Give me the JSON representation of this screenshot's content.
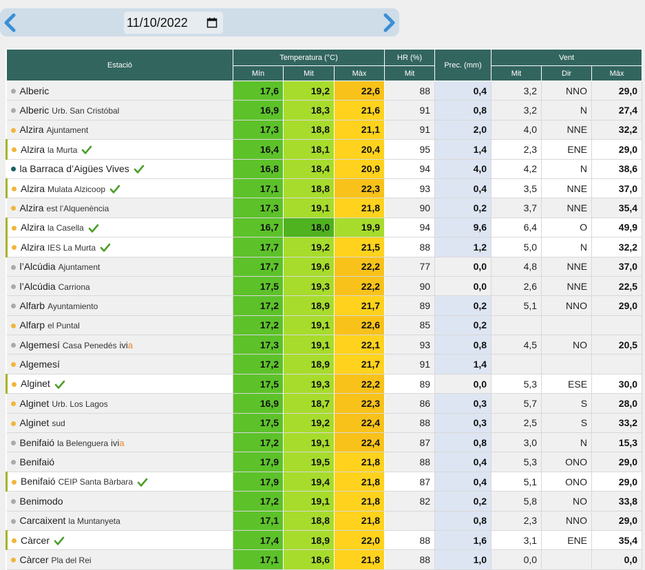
{
  "date": {
    "value": "11/10/2022"
  },
  "headers": {
    "station": "Estació",
    "temperature": "Temperatura (°C)",
    "humidity": "HR (%)",
    "precip": "Prec. (mm)",
    "wind": "Vent",
    "min": "Mín",
    "mit": "Mit",
    "max": "Màx",
    "dir": "Dir"
  },
  "colors": {
    "header_bg": "#33655f",
    "min_cell": "#5dc22a",
    "min_cell_dark": "#4fb21f",
    "mit_cell": "#a7dc2c",
    "max_cell": "#ffd21d",
    "max_cell_orange": "#f8c21a",
    "precip_bg": "#dde5f2",
    "check": "#4d9f2a",
    "nav_arrow": "#3b8fd6"
  },
  "rows": [
    {
      "name": "Alberic",
      "sub": "",
      "dot": "grey",
      "check": false,
      "hl": false,
      "ivia": false,
      "tmin": "17,6",
      "tmit": "19,2",
      "tmax": "22,6",
      "hr": "88",
      "prec": "0,4",
      "vmit": "3,2",
      "dir": "NNO",
      "vmax": "29,0"
    },
    {
      "name": "Alberic",
      "sub": "Urb. San Cristóbal",
      "dot": "grey",
      "check": false,
      "hl": false,
      "ivia": false,
      "tmin": "16,9",
      "tmit": "18,3",
      "tmax": "21,6",
      "hr": "91",
      "prec": "0,8",
      "vmit": "3,2",
      "dir": "N",
      "vmax": "27,4"
    },
    {
      "name": "Alzira",
      "sub": "Ajuntament",
      "dot": "yellow",
      "check": false,
      "hl": false,
      "ivia": false,
      "tmin": "17,3",
      "tmit": "18,8",
      "tmax": "21,1",
      "hr": "91",
      "prec": "2,0",
      "vmit": "4,0",
      "dir": "NNE",
      "vmax": "32,2"
    },
    {
      "name": "Alzira",
      "sub": "la Murta",
      "dot": "yellow",
      "check": true,
      "hl": true,
      "ivia": false,
      "tmin": "16,4",
      "tmit": "18,1",
      "tmax": "20,4",
      "hr": "95",
      "prec": "1,4",
      "vmit": "2,3",
      "dir": "ENE",
      "vmax": "29,0"
    },
    {
      "name": "la Barraca d’Aigües Vives",
      "sub": "",
      "dot": "teal",
      "check": true,
      "hl": false,
      "ivia": false,
      "tmin": "16,8",
      "tmit": "18,4",
      "tmax": "20,9",
      "hr": "94",
      "prec": "4,0",
      "vmit": "4,2",
      "dir": "N",
      "vmax": "38,6"
    },
    {
      "name": "Alzira",
      "sub": "Mulata Alzicoop",
      "dot": "yellow",
      "check": true,
      "hl": true,
      "ivia": false,
      "tmin": "17,1",
      "tmit": "18,8",
      "tmax": "22,3",
      "hr": "93",
      "prec": "0,4",
      "vmit": "3,5",
      "dir": "NNE",
      "vmax": "37,0"
    },
    {
      "name": "Alzira",
      "sub": "est l’Alquenència",
      "dot": "yellow",
      "check": false,
      "hl": false,
      "ivia": false,
      "tmin": "17,3",
      "tmit": "19,1",
      "tmax": "21,8",
      "hr": "90",
      "prec": "0,2",
      "vmit": "3,7",
      "dir": "NNE",
      "vmax": "35,4"
    },
    {
      "name": "Alzira",
      "sub": "la Casella",
      "dot": "yellow",
      "check": true,
      "hl": true,
      "ivia": false,
      "tmin": "16,7",
      "tmit": "18,0",
      "tmax": "19,9",
      "hr": "94",
      "prec": "9,6",
      "vmit": "6,4",
      "dir": "O",
      "vmax": "49,9"
    },
    {
      "name": "Alzira",
      "sub": "IES La Murta",
      "dot": "yellow",
      "check": true,
      "hl": true,
      "ivia": false,
      "tmin": "17,7",
      "tmit": "19,2",
      "tmax": "21,5",
      "hr": "88",
      "prec": "1,2",
      "vmit": "5,0",
      "dir": "N",
      "vmax": "32,2"
    },
    {
      "name": "l’Alcúdia",
      "sub": "Ajuntament",
      "dot": "grey",
      "check": false,
      "hl": false,
      "ivia": false,
      "tmin": "17,7",
      "tmit": "19,6",
      "tmax": "22,2",
      "hr": "77",
      "prec": "0,0",
      "vmit": "4,8",
      "dir": "NNE",
      "vmax": "37,0"
    },
    {
      "name": "l’Alcúdia",
      "sub": "Carriona",
      "dot": "grey",
      "check": false,
      "hl": false,
      "ivia": false,
      "tmin": "17,5",
      "tmit": "19,3",
      "tmax": "22,2",
      "hr": "90",
      "prec": "0,0",
      "vmit": "2,6",
      "dir": "NNE",
      "vmax": "22,5"
    },
    {
      "name": "Alfarb",
      "sub": "Ayuntamiento",
      "dot": "grey",
      "check": false,
      "hl": false,
      "ivia": false,
      "tmin": "17,2",
      "tmit": "18,9",
      "tmax": "21,7",
      "hr": "89",
      "prec": "0,2",
      "vmit": "5,1",
      "dir": "NNO",
      "vmax": "29,0"
    },
    {
      "name": "Alfarp",
      "sub": "el Puntal",
      "dot": "yellow",
      "check": false,
      "hl": false,
      "ivia": false,
      "tmin": "17,2",
      "tmit": "19,1",
      "tmax": "22,6",
      "hr": "85",
      "prec": "0,2",
      "vmit": "",
      "dir": "",
      "vmax": ""
    },
    {
      "name": "Algemesí",
      "sub": "Casa Penedés",
      "dot": "grey",
      "check": false,
      "hl": false,
      "ivia": true,
      "tmin": "17,3",
      "tmit": "19,1",
      "tmax": "22,1",
      "hr": "93",
      "prec": "0,8",
      "vmit": "4,5",
      "dir": "NO",
      "vmax": "20,5"
    },
    {
      "name": "Algemesí",
      "sub": "",
      "dot": "yellow",
      "check": false,
      "hl": false,
      "ivia": false,
      "tmin": "17,2",
      "tmit": "18,9",
      "tmax": "21,7",
      "hr": "91",
      "prec": "1,4",
      "vmit": "",
      "dir": "",
      "vmax": ""
    },
    {
      "name": "Alginet",
      "sub": "",
      "dot": "yellow",
      "check": true,
      "hl": true,
      "ivia": false,
      "tmin": "17,5",
      "tmit": "19,3",
      "tmax": "22,2",
      "hr": "89",
      "prec": "0,0",
      "vmit": "5,3",
      "dir": "ESE",
      "vmax": "30,0"
    },
    {
      "name": "Alginet",
      "sub": "Urb. Los Lagos",
      "dot": "yellow",
      "check": false,
      "hl": false,
      "ivia": false,
      "tmin": "16,9",
      "tmit": "18,7",
      "tmax": "22,3",
      "hr": "86",
      "prec": "0,3",
      "vmit": "5,7",
      "dir": "S",
      "vmax": "28,0"
    },
    {
      "name": "Alginet",
      "sub": "sud",
      "dot": "yellow",
      "check": false,
      "hl": false,
      "ivia": false,
      "tmin": "17,5",
      "tmit": "19,2",
      "tmax": "22,4",
      "hr": "88",
      "prec": "0,3",
      "vmit": "2,5",
      "dir": "S",
      "vmax": "33,2"
    },
    {
      "name": "Benifaió",
      "sub": "la Belenguera",
      "dot": "grey",
      "check": false,
      "hl": false,
      "ivia": true,
      "tmin": "17,2",
      "tmit": "19,1",
      "tmax": "22,4",
      "hr": "87",
      "prec": "0,8",
      "vmit": "3,0",
      "dir": "N",
      "vmax": "15,3"
    },
    {
      "name": "Benifaió",
      "sub": "",
      "dot": "grey",
      "check": false,
      "hl": false,
      "ivia": false,
      "tmin": "17,9",
      "tmit": "19,5",
      "tmax": "21,8",
      "hr": "88",
      "prec": "0,4",
      "vmit": "5,3",
      "dir": "ONO",
      "vmax": "29,0"
    },
    {
      "name": "Benifaió",
      "sub": "CEIP Santa Bàrbara",
      "dot": "yellow",
      "check": true,
      "hl": true,
      "ivia": false,
      "tmin": "17,9",
      "tmit": "19,4",
      "tmax": "21,8",
      "hr": "87",
      "prec": "0,4",
      "vmit": "5,1",
      "dir": "ONO",
      "vmax": "29,0"
    },
    {
      "name": "Benimodo",
      "sub": "",
      "dot": "grey",
      "check": false,
      "hl": false,
      "ivia": false,
      "tmin": "17,2",
      "tmit": "19,1",
      "tmax": "21,8",
      "hr": "82",
      "prec": "0,2",
      "vmit": "5,8",
      "dir": "NO",
      "vmax": "33,8"
    },
    {
      "name": "Carcaixent",
      "sub": "la Muntanyeta",
      "dot": "grey",
      "check": false,
      "hl": false,
      "ivia": false,
      "tmin": "17,1",
      "tmit": "18,8",
      "tmax": "21,8",
      "hr": "",
      "prec": "0,8",
      "vmit": "2,3",
      "dir": "NNO",
      "vmax": "29,0"
    },
    {
      "name": "Càrcer",
      "sub": "",
      "dot": "yellow",
      "check": true,
      "hl": true,
      "ivia": false,
      "tmin": "17,4",
      "tmit": "18,9",
      "tmax": "22,0",
      "hr": "88",
      "prec": "1,6",
      "vmit": "3,1",
      "dir": "ENE",
      "vmax": "35,4"
    },
    {
      "name": "Càrcer",
      "sub": "Pla del Rei",
      "dot": "yellow",
      "check": false,
      "hl": false,
      "ivia": false,
      "tmin": "17,1",
      "tmit": "18,6",
      "tmax": "21,8",
      "hr": "88",
      "prec": "1,0",
      "vmit": "0,0",
      "dir": "",
      "vmax": "0,0"
    }
  ],
  "ivia_label": {
    "main": "ivi",
    "accent": "a"
  }
}
